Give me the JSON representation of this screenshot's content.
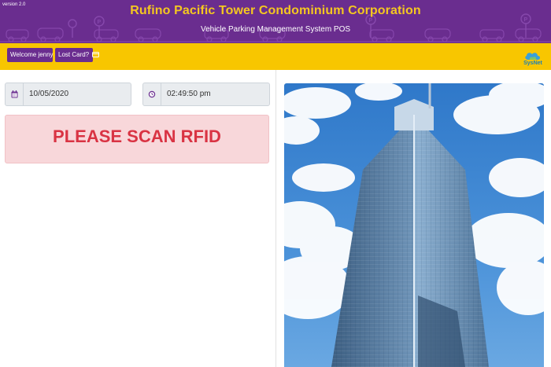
{
  "header": {
    "version": "version 2.0",
    "title": "Rufino Pacific Tower Condominium Corporation",
    "subtitle": "Vehicle Parking Management System POS"
  },
  "toolbar": {
    "welcome_label": "Welcome jenny",
    "lost_card_label": "Lost Card?",
    "logo_text": "SysNet"
  },
  "form": {
    "date_value": "10/05/2020",
    "time_value": "02:49:50 pm",
    "date_icon": "calendar-icon",
    "time_icon": "clock-icon"
  },
  "alert": {
    "message": "PLEASE SCAN RFID"
  },
  "colors": {
    "header_purple": "#6a2d8f",
    "title_gold": "#f4c720",
    "toolbar_yellow": "#f8c600",
    "alert_red": "#d93343",
    "alert_bg": "#f8d7da"
  }
}
